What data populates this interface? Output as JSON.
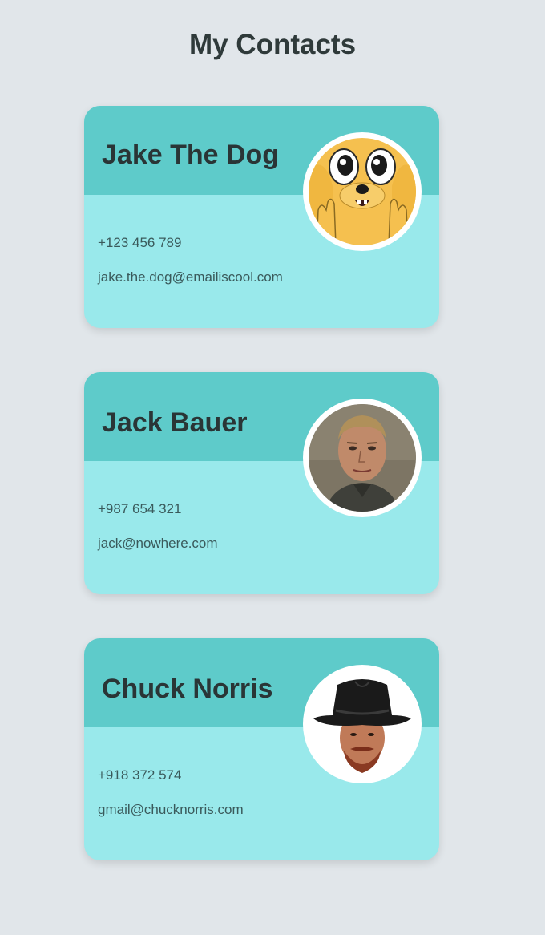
{
  "page": {
    "title": "My Contacts"
  },
  "colors": {
    "background": "#e1e6ea",
    "card_body": "#99e9eb",
    "card_header": "#5ecbca",
    "text_dark": "#2a3536",
    "text_muted": "#3a5a5b"
  },
  "contacts": [
    {
      "name": "Jake The Dog",
      "phone": "+123 456 789",
      "email": "jake.the.dog@emailiscool.com",
      "avatar_icon": "jake-the-dog-avatar-icon"
    },
    {
      "name": "Jack Bauer",
      "phone": "+987 654 321",
      "email": "jack@nowhere.com",
      "avatar_icon": "jack-bauer-avatar-icon"
    },
    {
      "name": "Chuck Norris",
      "phone": "+918 372 574",
      "email": "gmail@chucknorris.com",
      "avatar_icon": "chuck-norris-avatar-icon"
    }
  ]
}
